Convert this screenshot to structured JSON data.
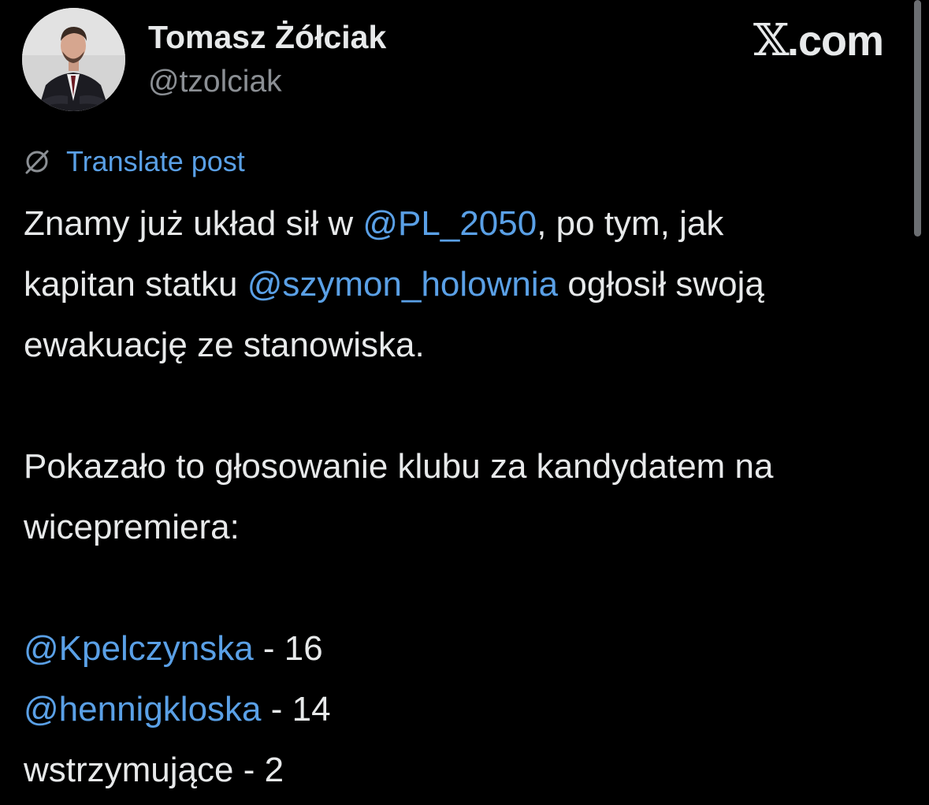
{
  "author": {
    "display_name": "Tomasz Żółciak",
    "handle": "@tzolciak",
    "avatar_icon": "profile-photo"
  },
  "brand": {
    "glyph": "𝕏",
    "suffix": ".com"
  },
  "translate": {
    "label": "Translate post",
    "icon": "globe-slash-icon"
  },
  "post": {
    "line1": {
      "pre": "Znamy już układ sił w ",
      "mention": "@PL_2050",
      "post": ", po tym, jak"
    },
    "line2": {
      "pre": "kapitan statku ",
      "mention": "@szymon_holownia",
      "post": " ogłosił swoją"
    },
    "line3": "ewakuację ze stanowiska.",
    "line4": "Pokazało to głosowanie klubu za kandydatem na",
    "line5": "wicepremiera:",
    "votes": [
      {
        "mention": "@Kpelczynska",
        "count_text": " - 16"
      },
      {
        "mention": "@hennigkloska",
        "count_text": " - 14"
      }
    ],
    "abstain": "wstrzymujące - 2"
  },
  "colors": {
    "background": "#000000",
    "text": "#e7e9ea",
    "secondary": "#8b8f94",
    "link": "#5aa0e6"
  }
}
